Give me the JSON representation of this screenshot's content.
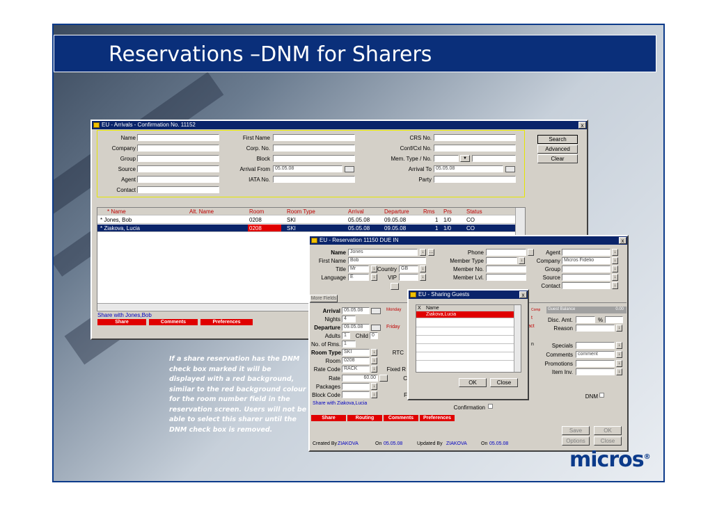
{
  "slide": {
    "title": "Reservations –DNM for Sharers",
    "note": "If a share reservation has the DNM check box marked it will be displayed with a red background, similar to the red background colour for the room number field in the reservation screen. Users will not be able to select this sharer until the DNM check box is removed.",
    "logo": "micros",
    "logo_mark": "®"
  },
  "arrivals": {
    "title": "EU - Arrivals - Confirmation No. 11152",
    "close": "x",
    "labels": {
      "name": "Name",
      "company": "Company",
      "group": "Group",
      "source": "Source",
      "agent": "Agent",
      "contact": "Contact",
      "first_name": "First Name",
      "corp_no": "Corp. No.",
      "block": "Block",
      "arrival_from": "Arrival From",
      "iata_no": "IATA No.",
      "crs_no": "CRS No.",
      "conf_cxl_no": "Conf/Cxl No.",
      "mem_type_no": "Mem. Type / No.",
      "arrival_to": "Arrival To",
      "party": "Party"
    },
    "values": {
      "arrival_from": "05.05.08",
      "arrival_to": "05.05.08"
    },
    "buttons": {
      "search": "Search",
      "advanced": "Advanced",
      "clear": "Clear"
    },
    "columns": [
      "* Name",
      "Alt. Name",
      "Room",
      "Room Type",
      "Arrival",
      "Departure",
      "Rms",
      "Prs",
      "Status"
    ],
    "rows": [
      [
        "* Jones, Bob",
        "",
        "0208",
        "SKI",
        "05.05.08",
        "09.05.08",
        "1",
        "1/0",
        "CO"
      ],
      [
        "* Ziakova, Lucia",
        "",
        "0208",
        "SKI",
        "05.05.08",
        "09.05.08",
        "1",
        "1/0",
        "CO"
      ]
    ],
    "share_with": "Share with Jones,Bob",
    "tabs": [
      "Share",
      "Comments",
      "Preferences"
    ]
  },
  "reservation": {
    "title": "EU - Reservation 11150  DUE IN",
    "close": "x",
    "labels": {
      "name": "Name",
      "first_name": "First Name",
      "title": "Title",
      "country": "Country",
      "language": "Language",
      "vip": "VIP",
      "phone": "Phone",
      "member_type": "Member Type",
      "member_no": "Member No.",
      "member_lvl": "Member Lvl.",
      "agent": "Agent",
      "company": "Company",
      "group": "Group",
      "source": "Source",
      "contact": "Contact",
      "more_fields": "More Fields",
      "arrival": "Arrival",
      "weekday_arrival": "Monday",
      "nights": "Nights",
      "departure": "Departure",
      "weekday_departure": "Friday",
      "adults": "Adults",
      "child": "Child",
      "no_of_rms": "No. of Rms.",
      "room_type": "Room Type",
      "rtc": "RTC",
      "room": "Room",
      "rate_code": "Rate Code",
      "fixed_r": "Fixed R",
      "rate": "Rate",
      "c": "C",
      "packages": "Packages",
      "block_code": "Block Code",
      "f": "F",
      "guest_balance": "Guest Balance",
      "disc_amt": "Disc. Amt.",
      "percent": "%",
      "reason": "Reason",
      "specials": "Specials",
      "comments": "Comments",
      "promotions": "Promotions",
      "item_inv": "Item Inv.",
      "dnm": "DNM",
      "confirmation": "Confirmation",
      "created_by": "Created By",
      "on": "On",
      "updated_by": "Updated By",
      "on2": "On",
      "comp_fragment": "Comp",
      "t_fragment": "t",
      "ract_fragment": "ract",
      "n_fragment": "n"
    },
    "values": {
      "name": "Jones",
      "first_name": "Bob",
      "title": "Mr",
      "country": "GB",
      "language": "E",
      "company": "Micros Fidelio",
      "arrival": "05.05.08",
      "nights": "4",
      "departure": "09.05.08",
      "adults": "1",
      "child": "0",
      "no_of_rms": "1",
      "room_type": "SKI",
      "room": "0208",
      "rate_code": "RACK",
      "rate": "60.00",
      "guest_balance": "0.00",
      "comments": "comment",
      "created_by": "ZIAKOVA",
      "created_on": "05.05.08",
      "updated_by": "ZIAKOVA",
      "updated_on": "05.05.08"
    },
    "share_with": "Share with Ziakova,Lucia",
    "tabs": [
      "Share",
      "Routing",
      "Comments",
      "Preferences"
    ],
    "buttons": {
      "save": "Save",
      "ok": "OK",
      "options": "Options",
      "close": "Close"
    }
  },
  "sharing": {
    "title": "EU - Sharing Guests",
    "close": "x",
    "col_x": "X",
    "col_name": "Name",
    "rows": [
      "Ziakova,Lucia"
    ],
    "buttons": {
      "ok": "OK",
      "close": "Close"
    }
  }
}
